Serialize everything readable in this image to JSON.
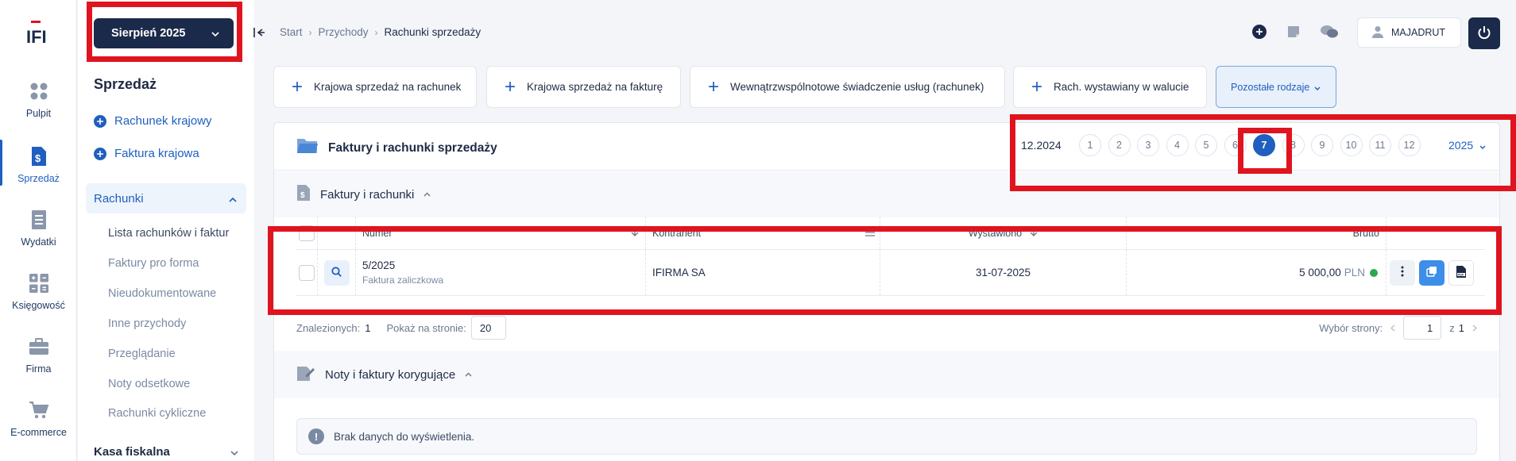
{
  "brand": {
    "logo_text": "IFI",
    "accent": "#1f5fbf",
    "dark": "#1b2a4a",
    "highlight": "#e0141e"
  },
  "rail": {
    "items": [
      {
        "label": "Pulpit",
        "icon": "dashboard-icon"
      },
      {
        "label": "Sprzedaż",
        "icon": "dollar-document-icon"
      },
      {
        "label": "Wydatki",
        "icon": "receipt-icon"
      },
      {
        "label": "Księgowość",
        "icon": "calculator-icon"
      },
      {
        "label": "Firma",
        "icon": "briefcase-icon"
      },
      {
        "label": "E-commerce",
        "icon": "cart-icon"
      }
    ]
  },
  "sidebar": {
    "month_button": "Sierpień 2025",
    "title": "Sprzedaż",
    "links": [
      "Rachunek krajowy",
      "Faktura krajowa"
    ],
    "group": "Rachunki",
    "sub_items": [
      "Lista rachunków i faktur",
      "Faktury pro forma",
      "Nieudokumentowane",
      "Inne przychody",
      "Przeglądanie",
      "Noty odsetkowe",
      "Rachunki cykliczne"
    ],
    "bottom_group": "Kasa fiskalna"
  },
  "header": {
    "breadcrumbs": [
      "Start",
      "Przychody",
      "Rachunki sprzedaży"
    ],
    "user": "MAJADRUT"
  },
  "tiles": [
    "Krajowa sprzedaż na rachunek",
    "Krajowa sprzedaż na fakturę",
    "Wewnątrzwspólnotowe świadczenie usług (rachunek)",
    "Rach. wystawiany w walucie",
    "Pozostałe rodzaje"
  ],
  "panel": {
    "title": "Faktury i rachunki sprzedaży",
    "month_picker": {
      "prev_label": "12.2024",
      "months": [
        "1",
        "2",
        "3",
        "4",
        "5",
        "6",
        "7",
        "8",
        "9",
        "10",
        "11",
        "12"
      ],
      "active": "7",
      "year": "2025"
    },
    "section1": "Faktury i rachunki",
    "table": {
      "headers": {
        "number": "Numer",
        "contractor": "Kontrahent",
        "issued": "Wystawiono",
        "gross": "Brutto"
      },
      "rows": [
        {
          "number": "5/2025",
          "type": "Faktura zaliczkowa",
          "contractor": "IFIRMA SA",
          "issued": "31-07-2025",
          "gross": "5 000,00",
          "currency": "PLN"
        }
      ]
    },
    "found_label": "Znalezionych:",
    "found_count": "1",
    "per_page_label": "Pokaż na stronie:",
    "per_page": "20",
    "page_select_label": "Wybór strony:",
    "page_current": "1",
    "page_of": "z",
    "page_total": "1",
    "section2": "Noty i faktury korygujące",
    "empty_message": "Brak danych do wyświetlenia."
  }
}
